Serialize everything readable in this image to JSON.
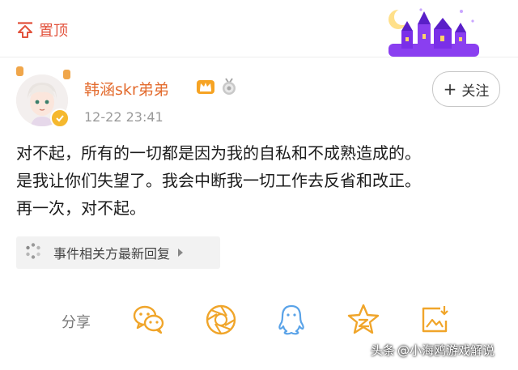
{
  "header": {
    "pin_label": "置顶"
  },
  "post": {
    "username": "韩涵skr弟弟",
    "timestamp": "12-22 23:41",
    "follow_label": "关注",
    "content_lines": [
      "对不起，所有的一切都是因为我的自私和不成熟造成的。",
      "是我让你们失望了。我会中断我一切工作去反省和改正。",
      "再一次，对不起。"
    ],
    "related_label": "事件相关方最新回复"
  },
  "share": {
    "label": "分享",
    "icons": [
      "wechat-icon",
      "moments-icon",
      "qq-icon",
      "qzone-icon",
      "save-image-icon"
    ]
  },
  "watermark": {
    "prefix": "头条",
    "text": "@小海鸥游戏解说"
  },
  "colors": {
    "accent": "#e36c2f",
    "pin": "#e2523c",
    "share_icon": "#f0a52a",
    "qq_icon": "#5aa3e8"
  }
}
